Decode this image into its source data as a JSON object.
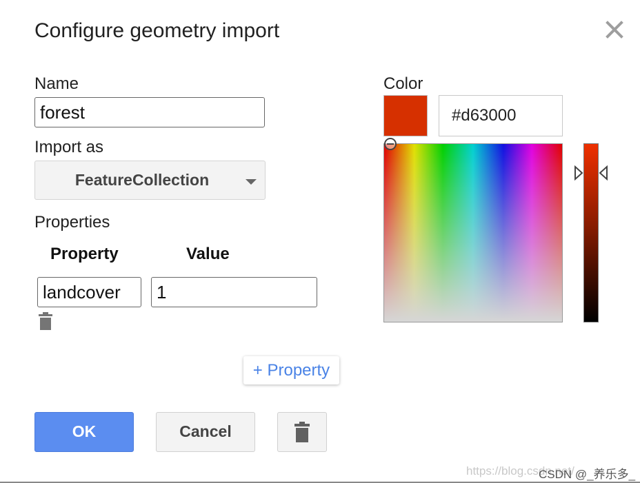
{
  "dialog": {
    "title": "Configure geometry import",
    "close_icon": "close-icon"
  },
  "name_field": {
    "label": "Name",
    "value": "forest"
  },
  "import_as": {
    "label": "Import as",
    "selected": "FeatureCollection"
  },
  "properties": {
    "label": "Properties",
    "columns": [
      "Property",
      "Value"
    ],
    "rows": [
      {
        "property": "landcover",
        "value": "1"
      }
    ],
    "add_label": "+ Property"
  },
  "color": {
    "label": "Color",
    "hex": "#d63000",
    "swatch": "#d63000"
  },
  "buttons": {
    "ok": "OK",
    "cancel": "Cancel",
    "delete_icon": "trash-icon"
  },
  "watermark": {
    "url": "https://blog.csdn.net/",
    "credit": "CSDN @_养乐多_"
  }
}
